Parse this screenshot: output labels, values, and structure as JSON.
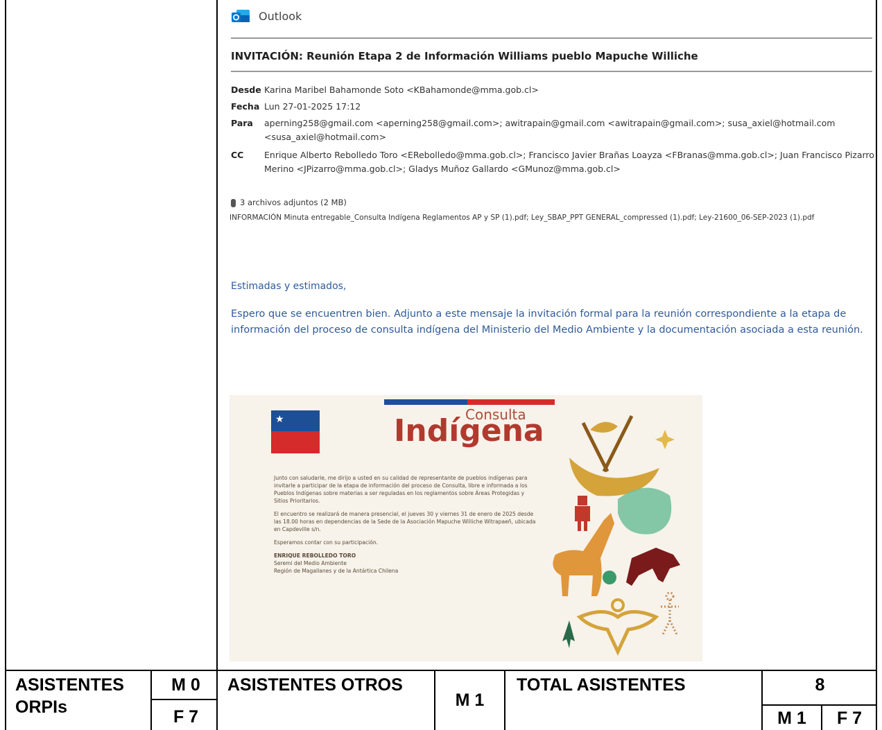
{
  "email": {
    "app_name": "Outlook",
    "subject": "INVITACIÓN: Reunión Etapa 2 de Información Williams pueblo Mapuche Williche",
    "headers": [
      {
        "key": "Desde",
        "value": "Karina Maribel Bahamonde Soto <KBahamonde@mma.gob.cl>"
      },
      {
        "key": "Fecha",
        "value": "Lun 27-01-2025 17:12"
      },
      {
        "key": "Para",
        "value": "aperning258@gmail.com <aperning258@gmail.com>; awitrapain@gmail.com <awitrapain@gmail.com>; susa_axiel@hotmail.com <susa_axiel@hotmail.com>"
      },
      {
        "key": "CC",
        "value": "Enrique Alberto Rebolledo Toro <ERebolledo@mma.gob.cl>; Francisco Javier Brañas Loayza <FBranas@mma.gob.cl>; Juan Francisco Pizarro Merino <JPizarro@mma.gob.cl>; Gladys Muñoz Gallardo <GMunoz@mma.gob.cl>"
      }
    ],
    "attachments_label": "3 archivos adjuntos (2 MB)",
    "attachments_files": "INFORMACIÓN Minuta entregable_Consulta Indígena Reglamentos AP y SP (1).pdf; Ley_SBAP_PPT GENERAL_compressed (1).pdf; Ley-21600_06-SEP-2023 (1).pdf",
    "greeting": "Estimadas y estimados,",
    "body": "Espero que se encuentren bien. Adjunto a este mensaje la invitación formal para la reunión correspondiente a la etapa de información del proceso de consulta indígena del Ministerio del Medio Ambiente y la documentación asociada a esta reunión."
  },
  "invitation": {
    "title_small": "Consulta",
    "title_big": "Indígena",
    "paragraph1": "Junto con saludarle, me dirijo a usted en su calidad de representante de pueblos indígenas para invitarle a participar de la etapa de información del proceso de Consulta, libre e informada a los Pueblos Indígenas sobre materias a ser reguladas en los reglamentos sobre Áreas Protegidas y Sitios Prioritarios.",
    "paragraph2": "El encuentro se realizará de manera presencial, el jueves 30 y viernes 31 de enero de 2025 desde las 18.00 horas en dependencias de la Sede de la Asociación Mapuche Williche Witrapaeñ, ubicada en Capdeville s/n.",
    "paragraph3": "Esperamos contar con su participación.",
    "signer": "ENRIQUE REBOLLEDO TORO",
    "signer_title1": "Seremi del Medio Ambiente",
    "signer_title2": "Región de Magallanes y de la Antártica Chilena"
  },
  "table": {
    "orpis_label": "ASISTENTES ORPIs",
    "orpis_m": "M 0",
    "orpis_f": "F 7",
    "otros_label": "ASISTENTES OTROS",
    "otros_m": "M 1",
    "total_label": "TOTAL ASISTENTES",
    "total_value": "8",
    "total_m": "M 1",
    "total_f": "F 7"
  },
  "colors": {
    "link_blue": "#2f5a9a",
    "title_red": "#b03a2e"
  }
}
